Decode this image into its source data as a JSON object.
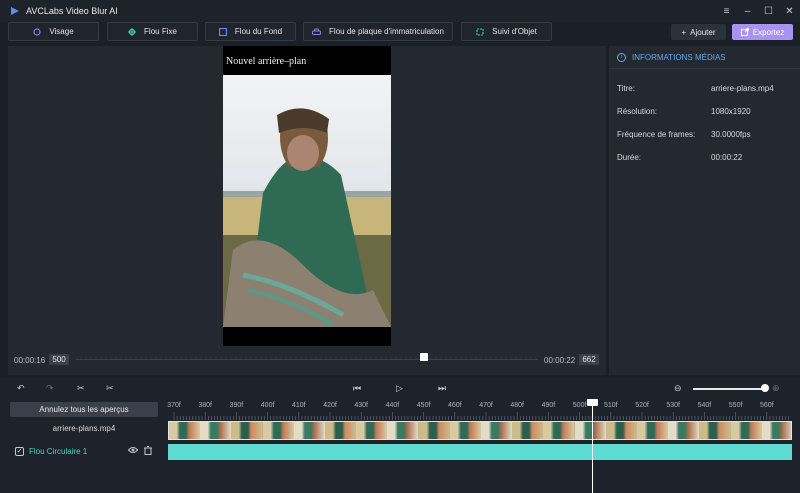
{
  "app": {
    "title": "AVCLabs Video Blur AI"
  },
  "window": {
    "menu_icon": "menu-icon",
    "minimize_icon": "minimize-icon",
    "maximize_icon": "maximize-icon",
    "close_icon": "close-icon"
  },
  "toolbar": {
    "face_label": "Visage",
    "fixed_blur_label": "Flou Fixe",
    "background_blur_label": "Flou du Fond",
    "plate_blur_label": "Flou de plaque d'immatriculation",
    "object_track_label": "Suivi d'Objet",
    "add_label": "Ajouter",
    "export_label": "Exportez"
  },
  "preview": {
    "video_caption": "Nouvel arrière–plan",
    "current_time": "00:00:16",
    "current_frame": "500",
    "end_time": "00:00:22",
    "end_frame": "662",
    "scrub_position": 0.75
  },
  "info": {
    "header": "INFORMATIONS MÉDIAS",
    "rows": [
      {
        "label": "Titre:",
        "value": "arriere-plans.mp4"
      },
      {
        "label": "Résolution:",
        "value": "1080x1920"
      },
      {
        "label": "Fréquence de frames:",
        "value": "30.0000fps"
      },
      {
        "label": "Durée:",
        "value": "00:00:22"
      }
    ]
  },
  "timeline": {
    "undo_all_label": "Annulez tous les aperçus",
    "track_name": "arriere-plans.mp4",
    "layer_name": "Flou Circulaire 1",
    "layer_checked": true,
    "ruler_labels": [
      "370f",
      "380f",
      "390f",
      "400f",
      "410f",
      "420f",
      "430f",
      "440f",
      "450f",
      "460f",
      "470f",
      "480f",
      "490f",
      "500f",
      "510f",
      "520f",
      "530f",
      "540f",
      "550f",
      "560f"
    ],
    "zoom_level": 0.95,
    "colors": {
      "blur_track": "#5fdcd2",
      "accent": "#a794f0",
      "info": "#6aa8e8"
    }
  }
}
